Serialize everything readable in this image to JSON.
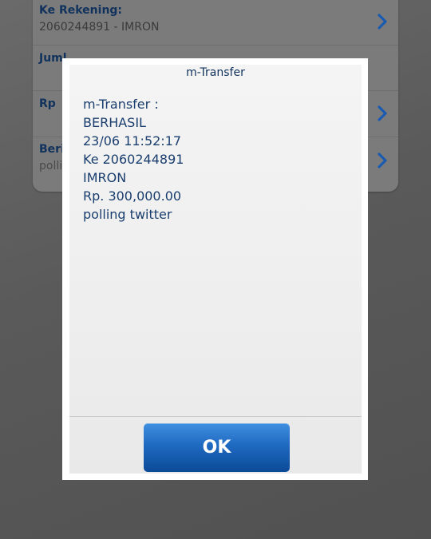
{
  "form": {
    "rows": [
      {
        "label": "Ke Rekening:",
        "value": "2060244891 - IMRON"
      },
      {
        "label": "Juml",
        "value": ""
      },
      {
        "label": "Rp",
        "value": ""
      },
      {
        "label": "Berit",
        "value": "pollin"
      }
    ]
  },
  "dialog": {
    "title": "m-Transfer",
    "message": [
      "m-Transfer :",
      "BERHASIL",
      "23/06 11:52:17",
      "Ke 2060244891",
      "IMRON",
      "Rp. 300,000.00",
      "polling twitter"
    ],
    "ok_label": "OK"
  },
  "colors": {
    "accent": "#1a5bb0",
    "label_text": "#10325c",
    "chevron": "#1a5bb0"
  },
  "icons": {
    "row_chevron": "chevron-right-icon"
  }
}
